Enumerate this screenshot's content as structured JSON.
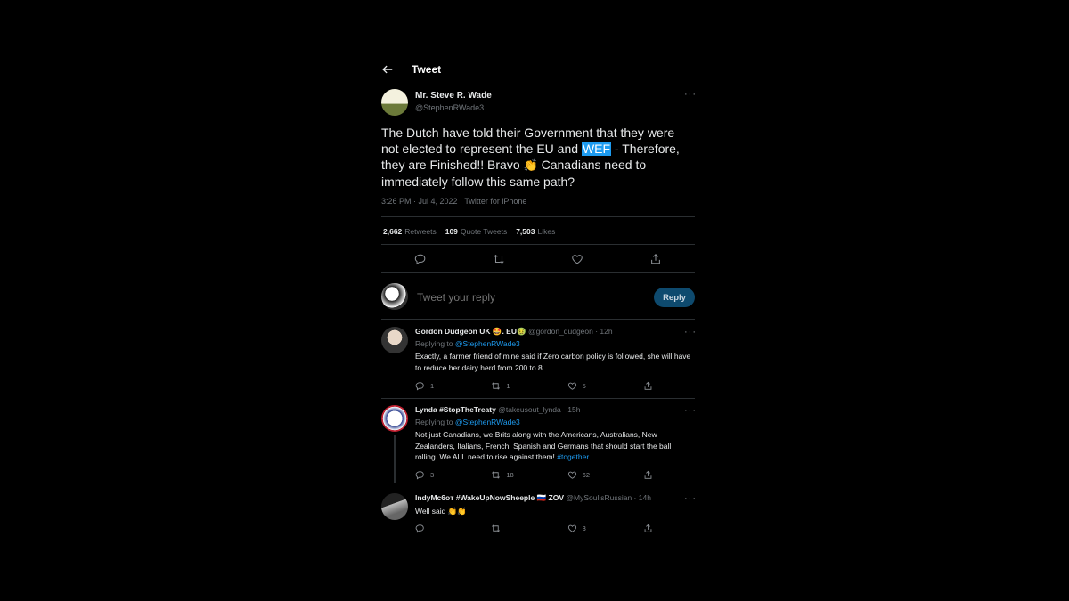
{
  "header": {
    "title": "Tweet",
    "back_icon": "arrow-left-icon"
  },
  "tweet": {
    "author_name": "Mr. Steve R. Wade",
    "author_handle": "@StephenRWade3",
    "text_before": "The Dutch have told their Government that they were not elected to represent the EU and ",
    "text_highlight": "WEF",
    "text_mid": " - Therefore, they are Finished!! Bravo ",
    "clap_emoji": "👏",
    "text_after": " Canadians need to immediately follow this same path?",
    "meta": "3:26 PM · Jul 4, 2022 · Twitter for iPhone",
    "stats": {
      "retweets_count": "2,662",
      "retweets_label": "Retweets",
      "quotes_count": "109",
      "quotes_label": "Quote Tweets",
      "likes_count": "7,503",
      "likes_label": "Likes"
    }
  },
  "reply_box": {
    "placeholder": "Tweet your reply",
    "button_label": "Reply"
  },
  "replies": [
    {
      "name": "Gordon Dudgeon UK 🤩. EU🤢",
      "handle_time": "@gordon_dudgeon · 12h",
      "replying_prefix": "Replying to ",
      "replying_to": "@StephenRWade3",
      "text": "Exactly, a farmer friend of mine said if Zero carbon policy is followed, she will have to reduce  her dairy herd from 200 to 8.",
      "replies": "1",
      "retweets": "1",
      "likes": "5"
    },
    {
      "name": "Lynda #StopTheTreaty",
      "handle_time": "@takeusout_lynda · 15h",
      "replying_prefix": "Replying to ",
      "replying_to": "@StephenRWade3",
      "text": "Not just Canadians, we Brits along with the Americans, Australians, New Zealanders, Italians, French, Spanish and Germans that should start the ball rolling. We ALL need to rise against them! ",
      "hashtag": "#together",
      "replies": "3",
      "retweets": "18",
      "likes": "62"
    },
    {
      "name": "IndyMc6oт #WakeUpNowSheeple 🇷🇺 ZOV",
      "handle_time": "@MySoulisRussian · 14h",
      "text": "Well said 👏👏",
      "replies": "",
      "retweets": "",
      "likes": "3"
    }
  ]
}
